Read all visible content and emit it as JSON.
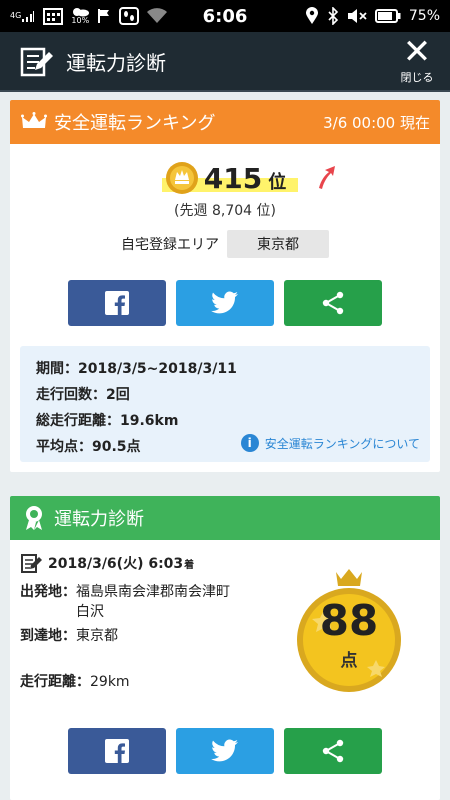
{
  "status_bar": {
    "network": "4G",
    "battery_small": "10%",
    "time": "6:06",
    "battery": "75%"
  },
  "header": {
    "title": "運転力診断",
    "close_label": "閉じる"
  },
  "ranking": {
    "title": "安全運転ランキング",
    "date": "3/6 00:00 現在",
    "rank": "415",
    "rank_unit": "位",
    "previous": "(先週 8,704 位)",
    "area_label": "自宅登録エリア",
    "area_value": "東京都",
    "period": "期間：2018/3/5~2018/3/11",
    "trips": "走行回数：2回",
    "distance": "総走行距離：19.6km",
    "average": "平均点：90.5点",
    "about_link": "安全運転ランキングについて"
  },
  "diagnosis": {
    "title": "運転力診断",
    "date": "2018/3/6(火) 6:03",
    "date_suffix": "着",
    "from_key": "出発地：",
    "from_value": "福島県南会津郡南会津町白沢",
    "to_key": "到達地：",
    "to_value": "東京都",
    "distance_key": "走行距離：",
    "distance_value": "29km",
    "score": "88",
    "score_unit": "点"
  },
  "colors": {
    "orange": "#f48a2a",
    "green": "#3fb35a",
    "facebook": "#3a5a98",
    "twitter": "#2b9fe3",
    "share": "#26a04a"
  },
  "icons": [
    "signal-icon",
    "calendar-icon",
    "weather-icon",
    "flag-icon",
    "footsteps-icon",
    "wifi-icon",
    "location-icon",
    "bluetooth-icon",
    "mute-icon",
    "battery-icon",
    "notepad-icon",
    "crown-icon",
    "medal-icon",
    "arrow-up-icon",
    "facebook-icon",
    "twitter-icon",
    "share-icon",
    "info-icon",
    "ribbon-icon"
  ]
}
